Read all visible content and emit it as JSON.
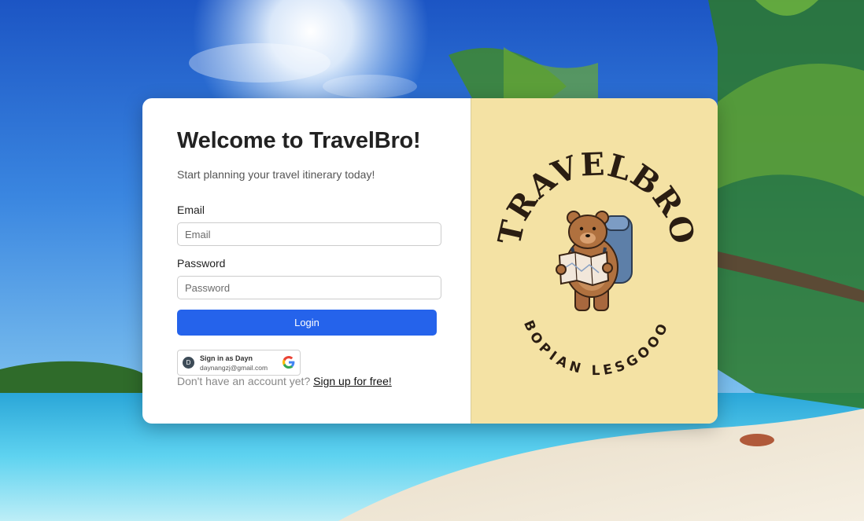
{
  "welcome": {
    "title": "Welcome to TravelBro!",
    "subtitle": "Start planning your travel itinerary today!"
  },
  "form": {
    "email_label": "Email",
    "email_placeholder": "Email",
    "email_value": "",
    "password_label": "Password",
    "password_placeholder": "Password",
    "password_value": "",
    "login_label": "Login"
  },
  "google": {
    "avatar_letter": "D",
    "signin_text": "Sign in as Dayn",
    "email": "daynangzj@gmail.com"
  },
  "signup": {
    "prompt": "Don't have an account yet?",
    "link": "Sign up for free!"
  },
  "logo": {
    "top_text": "TRAVELBRO",
    "bottom_text": "BOPIAN LESGOOO"
  },
  "colors": {
    "accent": "#2563eb",
    "panel": "#f4e2a4"
  }
}
